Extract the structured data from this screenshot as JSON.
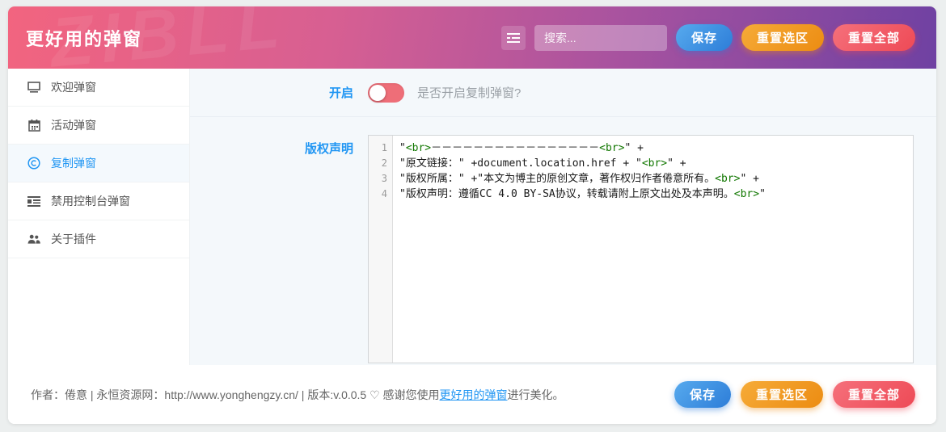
{
  "header": {
    "title": "更好用的弹窗",
    "watermark": "ZIBLL",
    "search_placeholder": "搜索...",
    "buttons": {
      "save": "保存",
      "reset_selection": "重置选区",
      "reset_all": "重置全部"
    }
  },
  "sidebar": {
    "items": [
      {
        "label": "欢迎弹窗",
        "icon": "monitor-icon",
        "active": false
      },
      {
        "label": "活动弹窗",
        "icon": "calendar-icon",
        "active": false
      },
      {
        "label": "复制弹窗",
        "icon": "copyright-icon",
        "active": true
      },
      {
        "label": "禁用控制台弹窗",
        "icon": "console-icon",
        "active": false
      },
      {
        "label": "关于插件",
        "icon": "users-icon",
        "active": false
      }
    ]
  },
  "main": {
    "toggle_row": {
      "label": "开启",
      "state": "on",
      "hint": "是否开启复制弹窗?"
    },
    "editor_row": {
      "label": "版权声明",
      "lines": [
        "\"<br>－－－－－－－－－－－－－－－－<br>\" +",
        "\"原文链接：\" +document.location.href + \"<br>\" +",
        "\"版权所属：\" +\"本文为博主的原创文章，著作权归作者倦意所有。<br>\" +",
        "\"版权声明：遵循CC 4.0 BY-SA协议，转载请附上原文出处及本声明。<br>\""
      ]
    }
  },
  "footer": {
    "text_before_link": "作者：倦意 | 永恒资源网：http://www.yonghengzy.cn/ | 版本:v.0.0.5 ♡ 感谢您使用",
    "link": "更好用的弹窗",
    "text_after_link": "进行美化。",
    "buttons": {
      "save": "保存",
      "reset_selection": "重置选区",
      "reset_all": "重置全部"
    }
  },
  "colors": {
    "header_gradient_start": "#f2647f",
    "header_gradient_end": "#6f41a2",
    "accent_blue": "#2196f3",
    "toggle_red": "#ee6e78",
    "button_blue": "#2d7dd8",
    "button_orange": "#ec8c12",
    "button_red": "#ee4a56",
    "code_tag_green": "#117700",
    "main_bg": "#f4f8fb"
  }
}
